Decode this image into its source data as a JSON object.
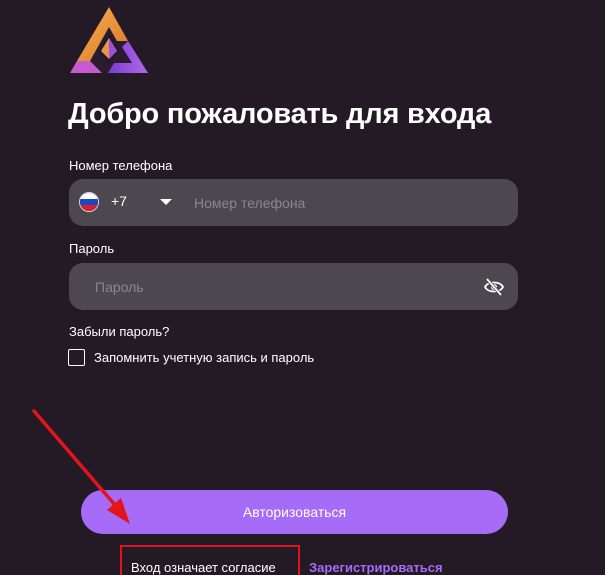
{
  "app": {
    "logo_icon": "triangle-logo-icon"
  },
  "header": {
    "title": "Добро пожаловать для входа"
  },
  "phone": {
    "label": "Номер телефона",
    "flag_icon": "russia-flag-icon",
    "dial_code": "+7",
    "dropdown_icon": "caret-down-icon",
    "placeholder": "Номер телефона",
    "value": ""
  },
  "password": {
    "label": "Пароль",
    "placeholder": "Пароль",
    "value": "",
    "toggle_icon": "eye-slash-icon"
  },
  "forgot_password": "Забыли пароль?",
  "remember": {
    "label": "Запомнить учетную запись и пароль",
    "checked": false
  },
  "login_button": "Авторизоваться",
  "footer": {
    "agreement_text": "Вход означает согласие",
    "register_link": "Зарегистрироваться"
  },
  "colors": {
    "background": "#241a26",
    "input_background": "#4d474f",
    "accent": "#a66bf7",
    "annotation": "#e2141c"
  }
}
